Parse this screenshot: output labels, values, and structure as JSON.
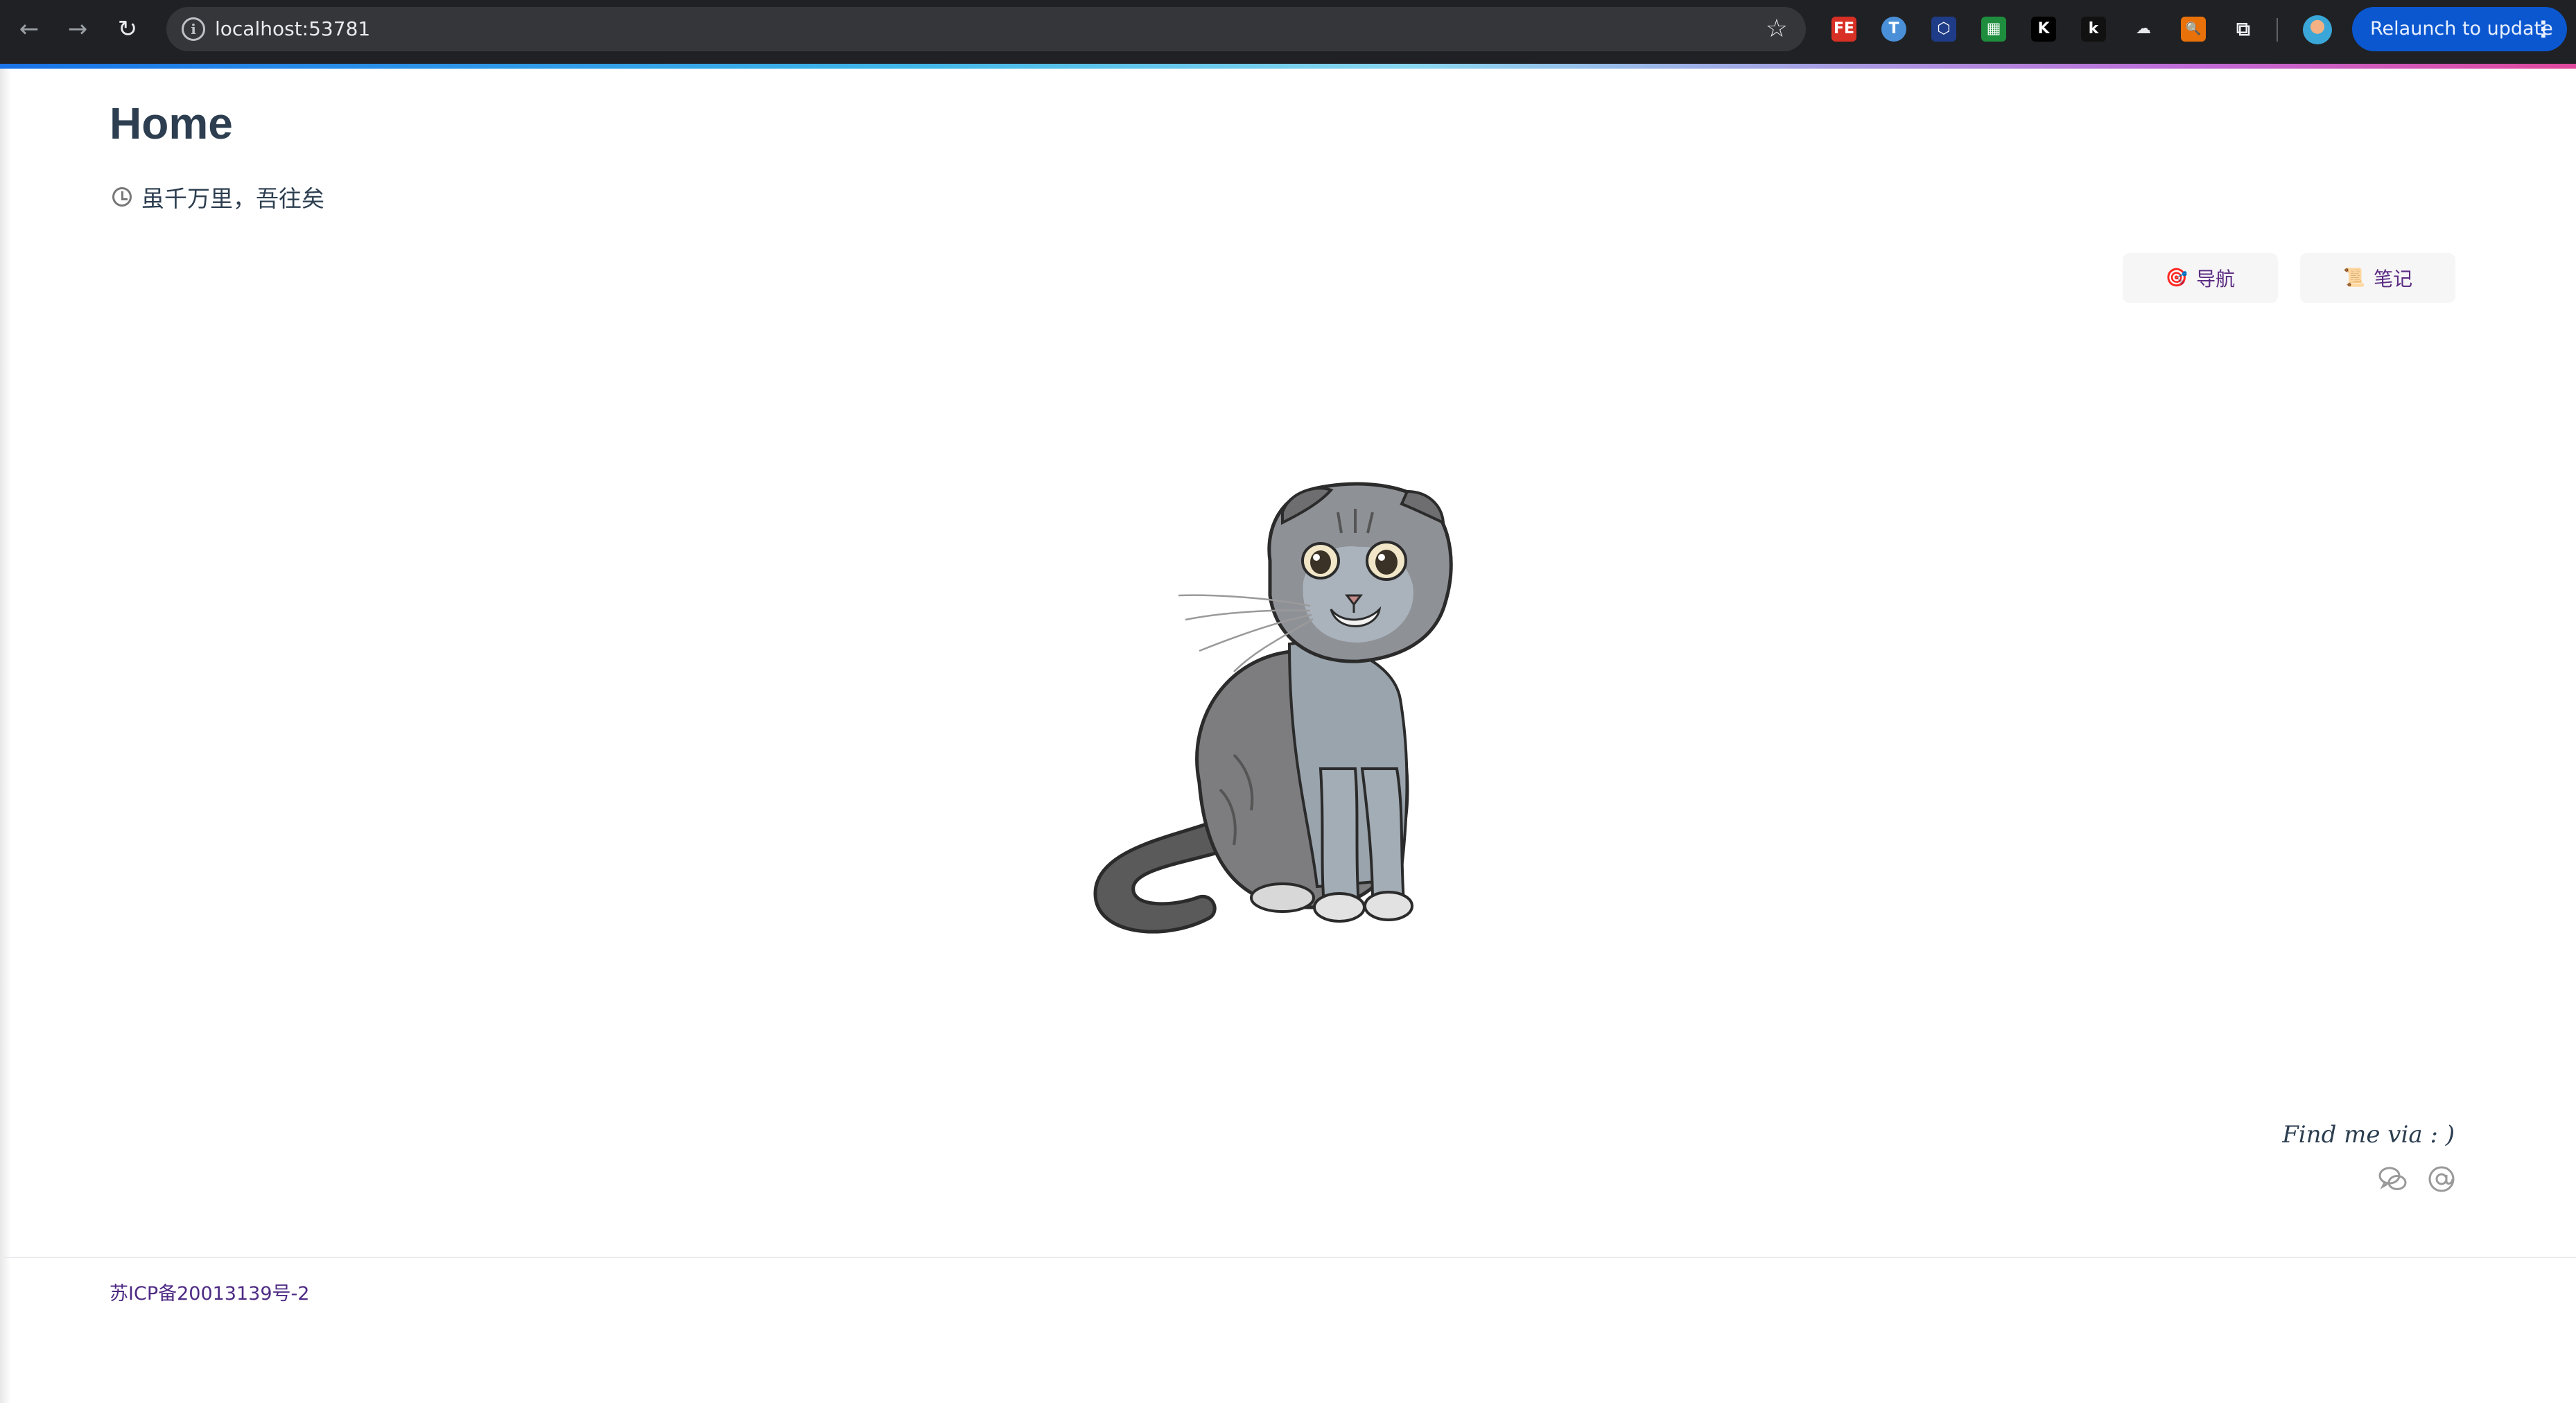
{
  "browser": {
    "url": "localhost:53781",
    "relaunch_label": "Relaunch to update",
    "extensions": [
      {
        "name": "fe-extension-icon",
        "glyph": "FE",
        "color": "#d93025"
      },
      {
        "name": "t-extension-icon",
        "glyph": "T",
        "color": "#4a90d9"
      },
      {
        "name": "hex-extension-icon",
        "glyph": "⬡",
        "color": "#1f3c88"
      },
      {
        "name": "green-extension-icon",
        "glyph": "▦",
        "color": "#1e8e3e"
      },
      {
        "name": "k-extension-icon",
        "glyph": "K",
        "color": "#000000"
      },
      {
        "name": "k-lower-extension-icon",
        "glyph": "k",
        "color": "#111111"
      },
      {
        "name": "cloud-extension-icon",
        "glyph": "☁",
        "color": "#202124"
      },
      {
        "name": "search-extension-icon",
        "glyph": "🔍",
        "color": "#e8710a"
      },
      {
        "name": "puzzle-extension-icon",
        "glyph": "⧉",
        "color": "#202124"
      }
    ]
  },
  "page": {
    "title": "Home",
    "subtitle": "虽千万里，吾往矣",
    "buttons": {
      "nav_label": "导航",
      "notes_label": "笔记"
    },
    "find_me": "Find me via : )",
    "footer": "苏ICP备20013139号-2"
  },
  "colors": {
    "title": "#2c3e50",
    "link_purple": "#5b2c83",
    "relaunch_blue": "#0b57d0"
  }
}
